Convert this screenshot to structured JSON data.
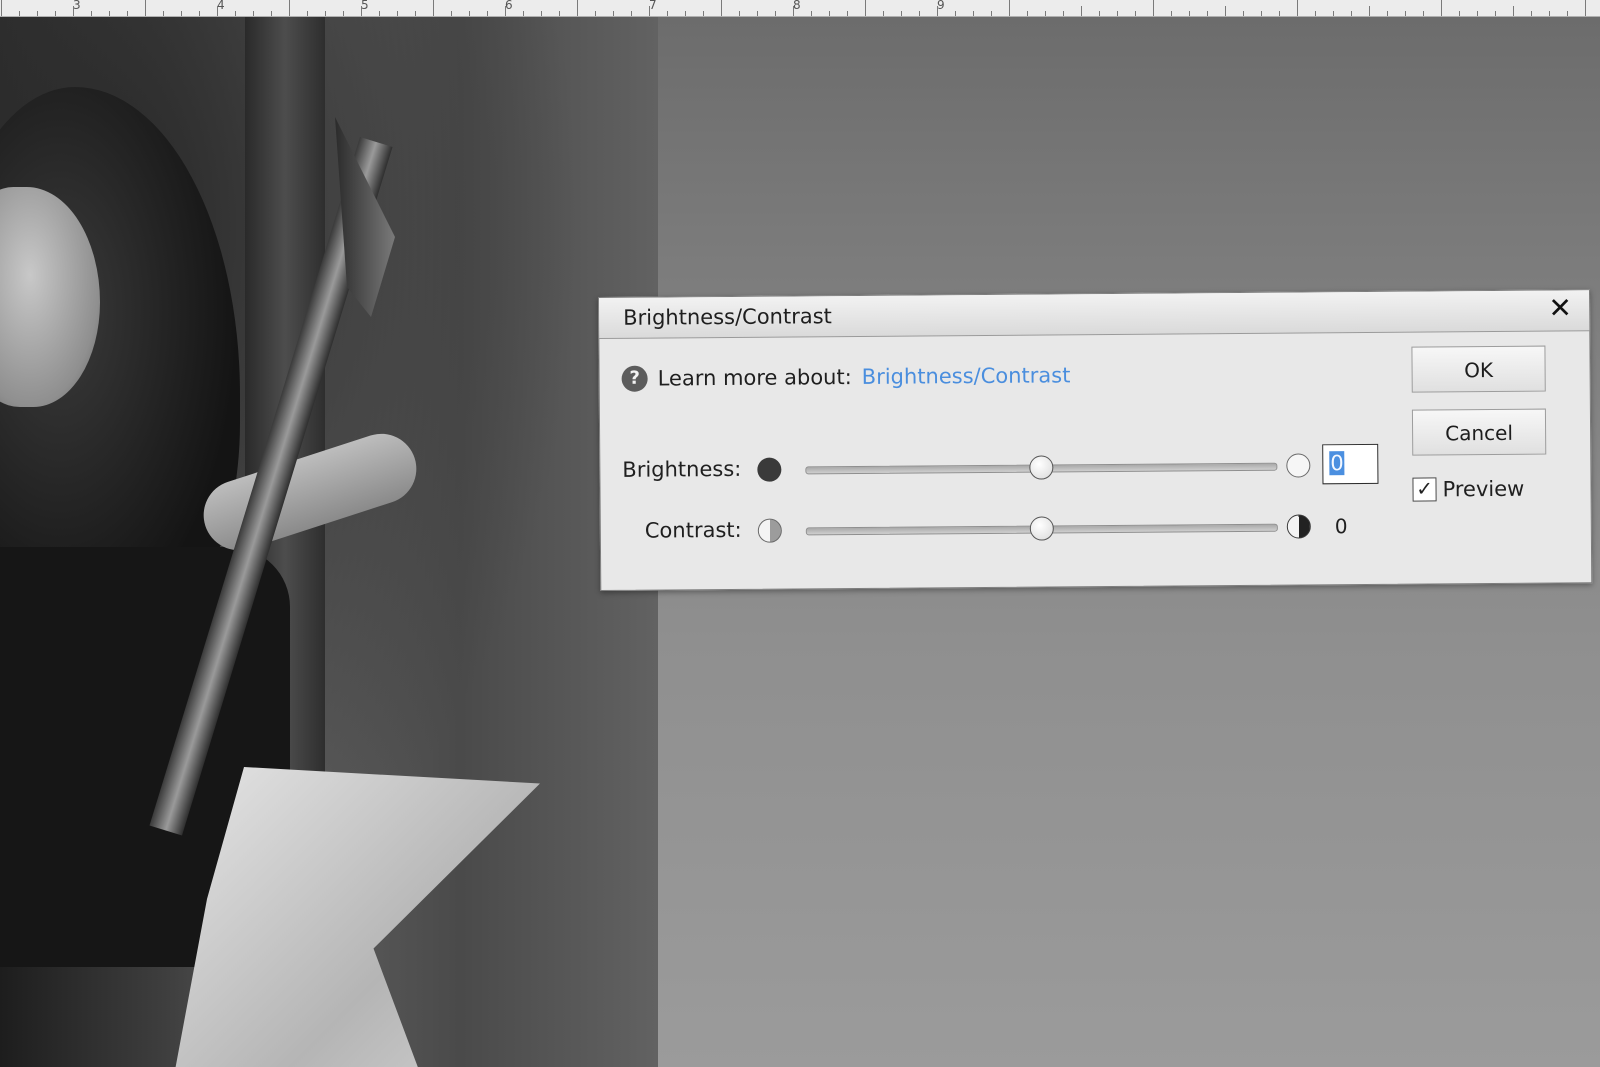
{
  "ruler": {
    "numbers": [
      "3",
      "4",
      "5",
      "6",
      "7",
      "8",
      "9"
    ]
  },
  "dialog": {
    "title": "Brightness/Contrast",
    "close_icon": "close-icon",
    "help_icon_glyph": "?",
    "learn_prefix": "Learn more about:",
    "learn_link": "Brightness/Contrast",
    "brightness": {
      "label": "Brightness:",
      "value": "0",
      "min_icon": "dark-circle-icon",
      "max_icon": "light-circle-icon",
      "position_fraction": 0.5
    },
    "contrast": {
      "label": "Contrast:",
      "value": "0",
      "min_icon": "low-contrast-icon",
      "max_icon": "high-contrast-icon",
      "position_fraction": 0.5
    },
    "ok_label": "OK",
    "cancel_label": "Cancel",
    "preview": {
      "label": "Preview",
      "checked": true
    }
  },
  "colors": {
    "link": "#4a8ede",
    "selection": "#4b8fe0"
  }
}
